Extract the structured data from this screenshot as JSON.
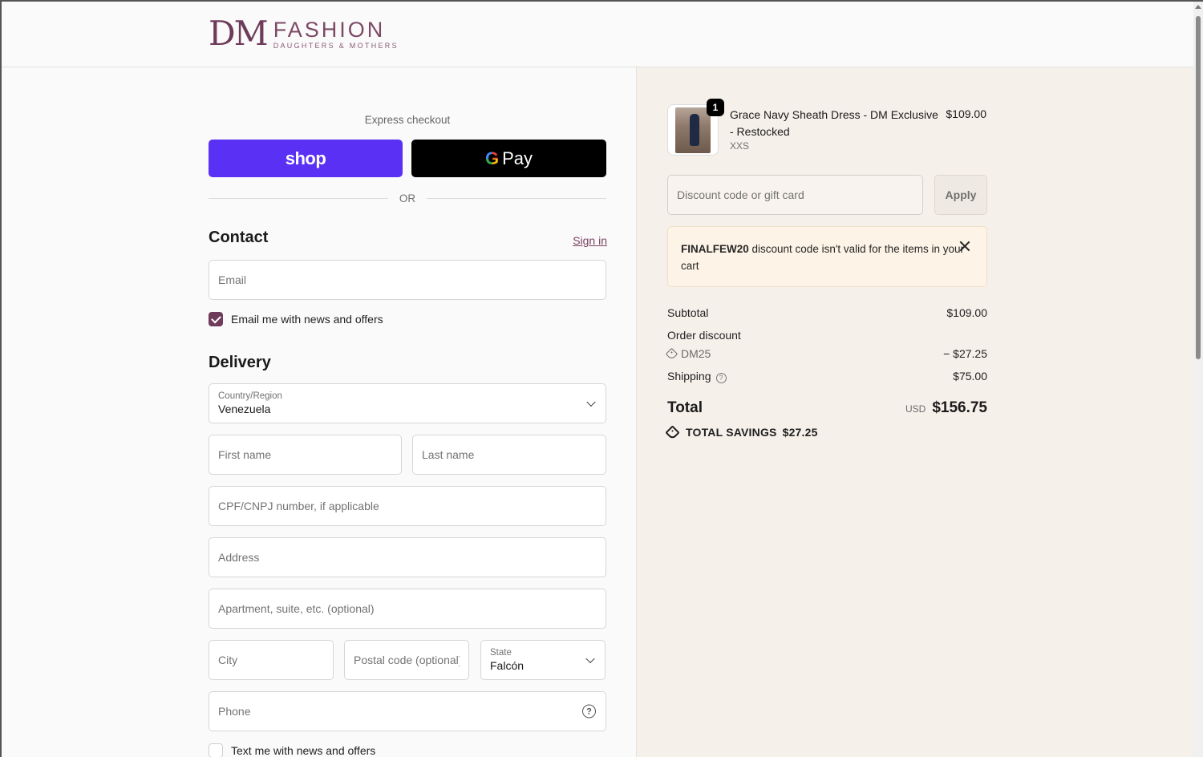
{
  "brand": {
    "logo_main": "DM",
    "logo_word": "FASHION",
    "logo_tagline": "DAUGHTERS & MOTHERS"
  },
  "express": {
    "label": "Express checkout",
    "shop_label": "shop",
    "gpay_g": "G",
    "gpay_label": "Pay",
    "or_label": "OR"
  },
  "contact": {
    "title": "Contact",
    "signin_label": "Sign in",
    "email_placeholder": "Email",
    "email_optin_label": "Email me with news and offers",
    "email_optin_checked": true
  },
  "delivery": {
    "title": "Delivery",
    "country_label": "Country/Region",
    "country_value": "Venezuela",
    "first_name_placeholder": "First name",
    "last_name_placeholder": "Last name",
    "cpf_placeholder": "CPF/CNPJ number, if applicable",
    "address_placeholder": "Address",
    "apartment_placeholder": "Apartment, suite, etc. (optional)",
    "city_placeholder": "City",
    "postal_placeholder": "Postal code (optional)",
    "state_label": "State",
    "state_value": "Falcón",
    "phone_placeholder": "Phone",
    "sms_optin_label": "Text me with news and offers",
    "sms_optin_checked": false
  },
  "order": {
    "item": {
      "quantity": "1",
      "name": "Grace Navy Sheath Dress - DM Exclusive - Restocked",
      "variant": "XXS",
      "price": "$109.00"
    },
    "discount_placeholder": "Discount code or gift card",
    "apply_label": "Apply",
    "notice": {
      "code": "FINALFEW20",
      "message": " discount code isn't valid for the items in your cart"
    },
    "subtotal_label": "Subtotal",
    "subtotal_value": "$109.00",
    "order_discount_label": "Order discount",
    "discount_code": "DM25",
    "discount_value": "− $27.25",
    "shipping_label": "Shipping",
    "shipping_value": "$75.00",
    "total_label": "Total",
    "currency": "USD",
    "total_value": "$156.75",
    "savings_label": "TOTAL SAVINGS",
    "savings_value": "$27.25"
  },
  "colors": {
    "brand": "#6f3b5a",
    "shop_pay": "#5a31f4",
    "notice_bg": "#fdf3e6",
    "summary_bg": "#f6f0ea"
  },
  "icons": [
    "chevron-down-icon",
    "help-circle-icon",
    "tag-icon",
    "close-icon",
    "check-icon"
  ]
}
